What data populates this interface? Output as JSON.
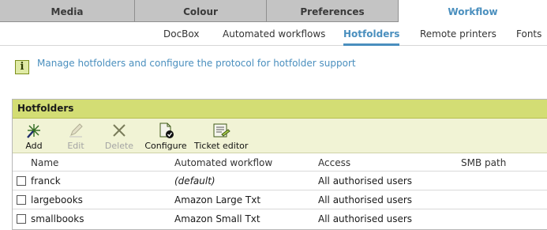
{
  "tabs": [
    {
      "label": "Media",
      "active": false
    },
    {
      "label": "Colour",
      "active": false
    },
    {
      "label": "Preferences",
      "active": false
    },
    {
      "label": "Workflow",
      "active": true
    }
  ],
  "subnav": [
    {
      "label": "DocBox"
    },
    {
      "label": "Automated workflows"
    },
    {
      "label": "Hotfolders",
      "active": true
    },
    {
      "label": "Remote printers"
    },
    {
      "label": "Fonts"
    }
  ],
  "info": {
    "icon": "info-icon",
    "text": "Manage hotfolders and configure the protocol for hotfolder support"
  },
  "panel": {
    "title": "Hotfolders",
    "toolbar": [
      {
        "label": "Add",
        "icon": "add-icon",
        "enabled": true
      },
      {
        "label": "Edit",
        "icon": "edit-icon",
        "enabled": false
      },
      {
        "label": "Delete",
        "icon": "delete-icon",
        "enabled": false
      },
      {
        "label": "Configure",
        "icon": "configure-icon",
        "enabled": true
      },
      {
        "label": "Ticket editor",
        "icon": "ticket-editor-icon",
        "enabled": true
      }
    ],
    "columns": [
      "Name",
      "Automated workflow",
      "Access",
      "SMB path"
    ],
    "rows": [
      {
        "name": "franck",
        "workflow": "(default)",
        "access": "All authorised users",
        "smb": ""
      },
      {
        "name": "largebooks",
        "workflow": "Amazon Large Txt",
        "access": "All authorised users",
        "smb": ""
      },
      {
        "name": "smallbooks",
        "workflow": "Amazon Small Txt",
        "access": "All authorised users",
        "smb": ""
      }
    ]
  },
  "colors": {
    "accent": "#4a8fbe",
    "panel_header": "#d3dd74",
    "toolbar_bg": "#f1f3d5",
    "tab_inactive": "#c4c4c4"
  }
}
